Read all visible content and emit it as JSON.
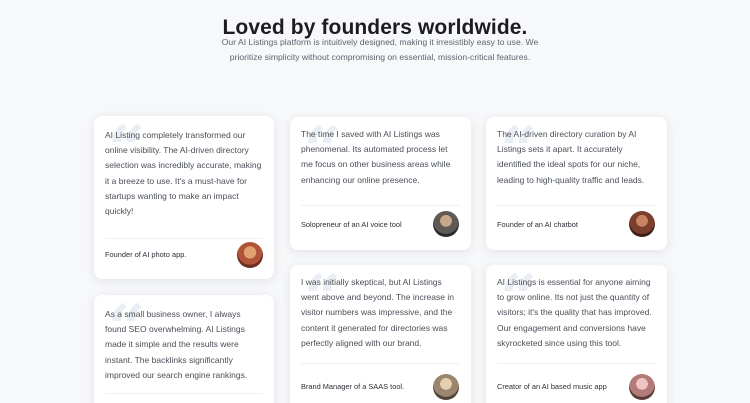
{
  "section": {
    "title": "Loved by founders worldwide.",
    "subtitle": "Our AI Listings platform is intuitively designed, making it irresistibly easy to use. We prioritize simplicity without compromising on essential, mission-critical features."
  },
  "testimonials": [
    {
      "text": "AI Listing completely transformed our online visibility. The AI-driven directory selection was incredibly accurate, making it a breeze to use. It's a must-have for startups wanting to make an impact quickly!",
      "author": "Founder of AI photo app."
    },
    {
      "text": "As a small business owner, I always found SEO overwhelming. AI Listings made it simple and the results were instant. The backlinks significantly improved our search engine rankings.",
      "author": ""
    },
    {
      "text": "The time I saved with AI Listings was phenomenal. Its automated process let me focus on other business areas while enhancing our online presence.",
      "author": "Solopreneur of an AI voice tool"
    },
    {
      "text": "I was initially skeptical, but AI Listings went above and beyond. The increase in visitor numbers was impressive, and the content it generated for directories was perfectly aligned with our brand.",
      "author": "Brand Manager of a SAAS tool."
    },
    {
      "text": "The AI-driven directory curation by AI Listings sets it apart. It accurately identified the ideal spots for our niche, leading to high-quality traffic and leads.",
      "author": "Founder of an AI chatbot"
    },
    {
      "text": "AI Listings is essential for anyone aiming to grow online. Its not just the quantity of visitors; it's the quality that has improved. Our engagement and conversions have skyrocketed since using this tool.",
      "author": "Creator of an AI based music app"
    }
  ]
}
